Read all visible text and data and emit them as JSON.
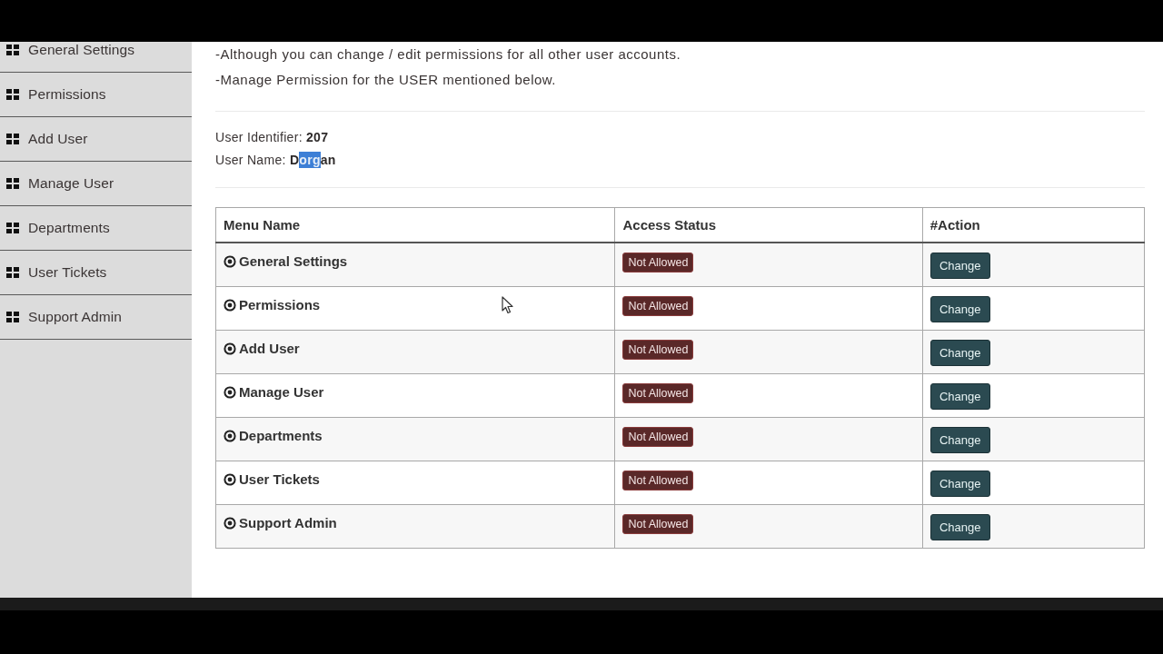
{
  "sidebar": {
    "items": [
      {
        "label": "General Settings"
      },
      {
        "label": "Permissions"
      },
      {
        "label": "Add User"
      },
      {
        "label": "Manage User"
      },
      {
        "label": "Departments"
      },
      {
        "label": "User Tickets"
      },
      {
        "label": "Support Admin"
      }
    ]
  },
  "notes": [
    "-Although you can change / edit permissions for all other user accounts.",
    "-Manage Permission for the USER mentioned below."
  ],
  "user_identifier": {
    "label": "User Identifier:",
    "value": "207"
  },
  "user_name": {
    "label": "User Name:",
    "value_parts": [
      {
        "text": "D",
        "selected": false
      },
      {
        "text": "org",
        "selected": true
      },
      {
        "text": "an",
        "selected": false
      }
    ]
  },
  "table": {
    "columns": [
      "Menu Name",
      "Access Status",
      "#Action"
    ],
    "rows": [
      {
        "menu_name": "General Settings",
        "access_status": "Not Allowed",
        "action": "Change"
      },
      {
        "menu_name": "Permissions",
        "access_status": "Not Allowed",
        "action": "Change"
      },
      {
        "menu_name": "Add User",
        "access_status": "Not Allowed",
        "action": "Change"
      },
      {
        "menu_name": "Manage User",
        "access_status": "Not Allowed",
        "action": "Change"
      },
      {
        "menu_name": "Departments",
        "access_status": "Not Allowed",
        "action": "Change"
      },
      {
        "menu_name": "User Tickets",
        "access_status": "Not Allowed",
        "action": "Change"
      },
      {
        "menu_name": "Support Admin",
        "access_status": "Not Allowed",
        "action": "Change"
      }
    ]
  }
}
